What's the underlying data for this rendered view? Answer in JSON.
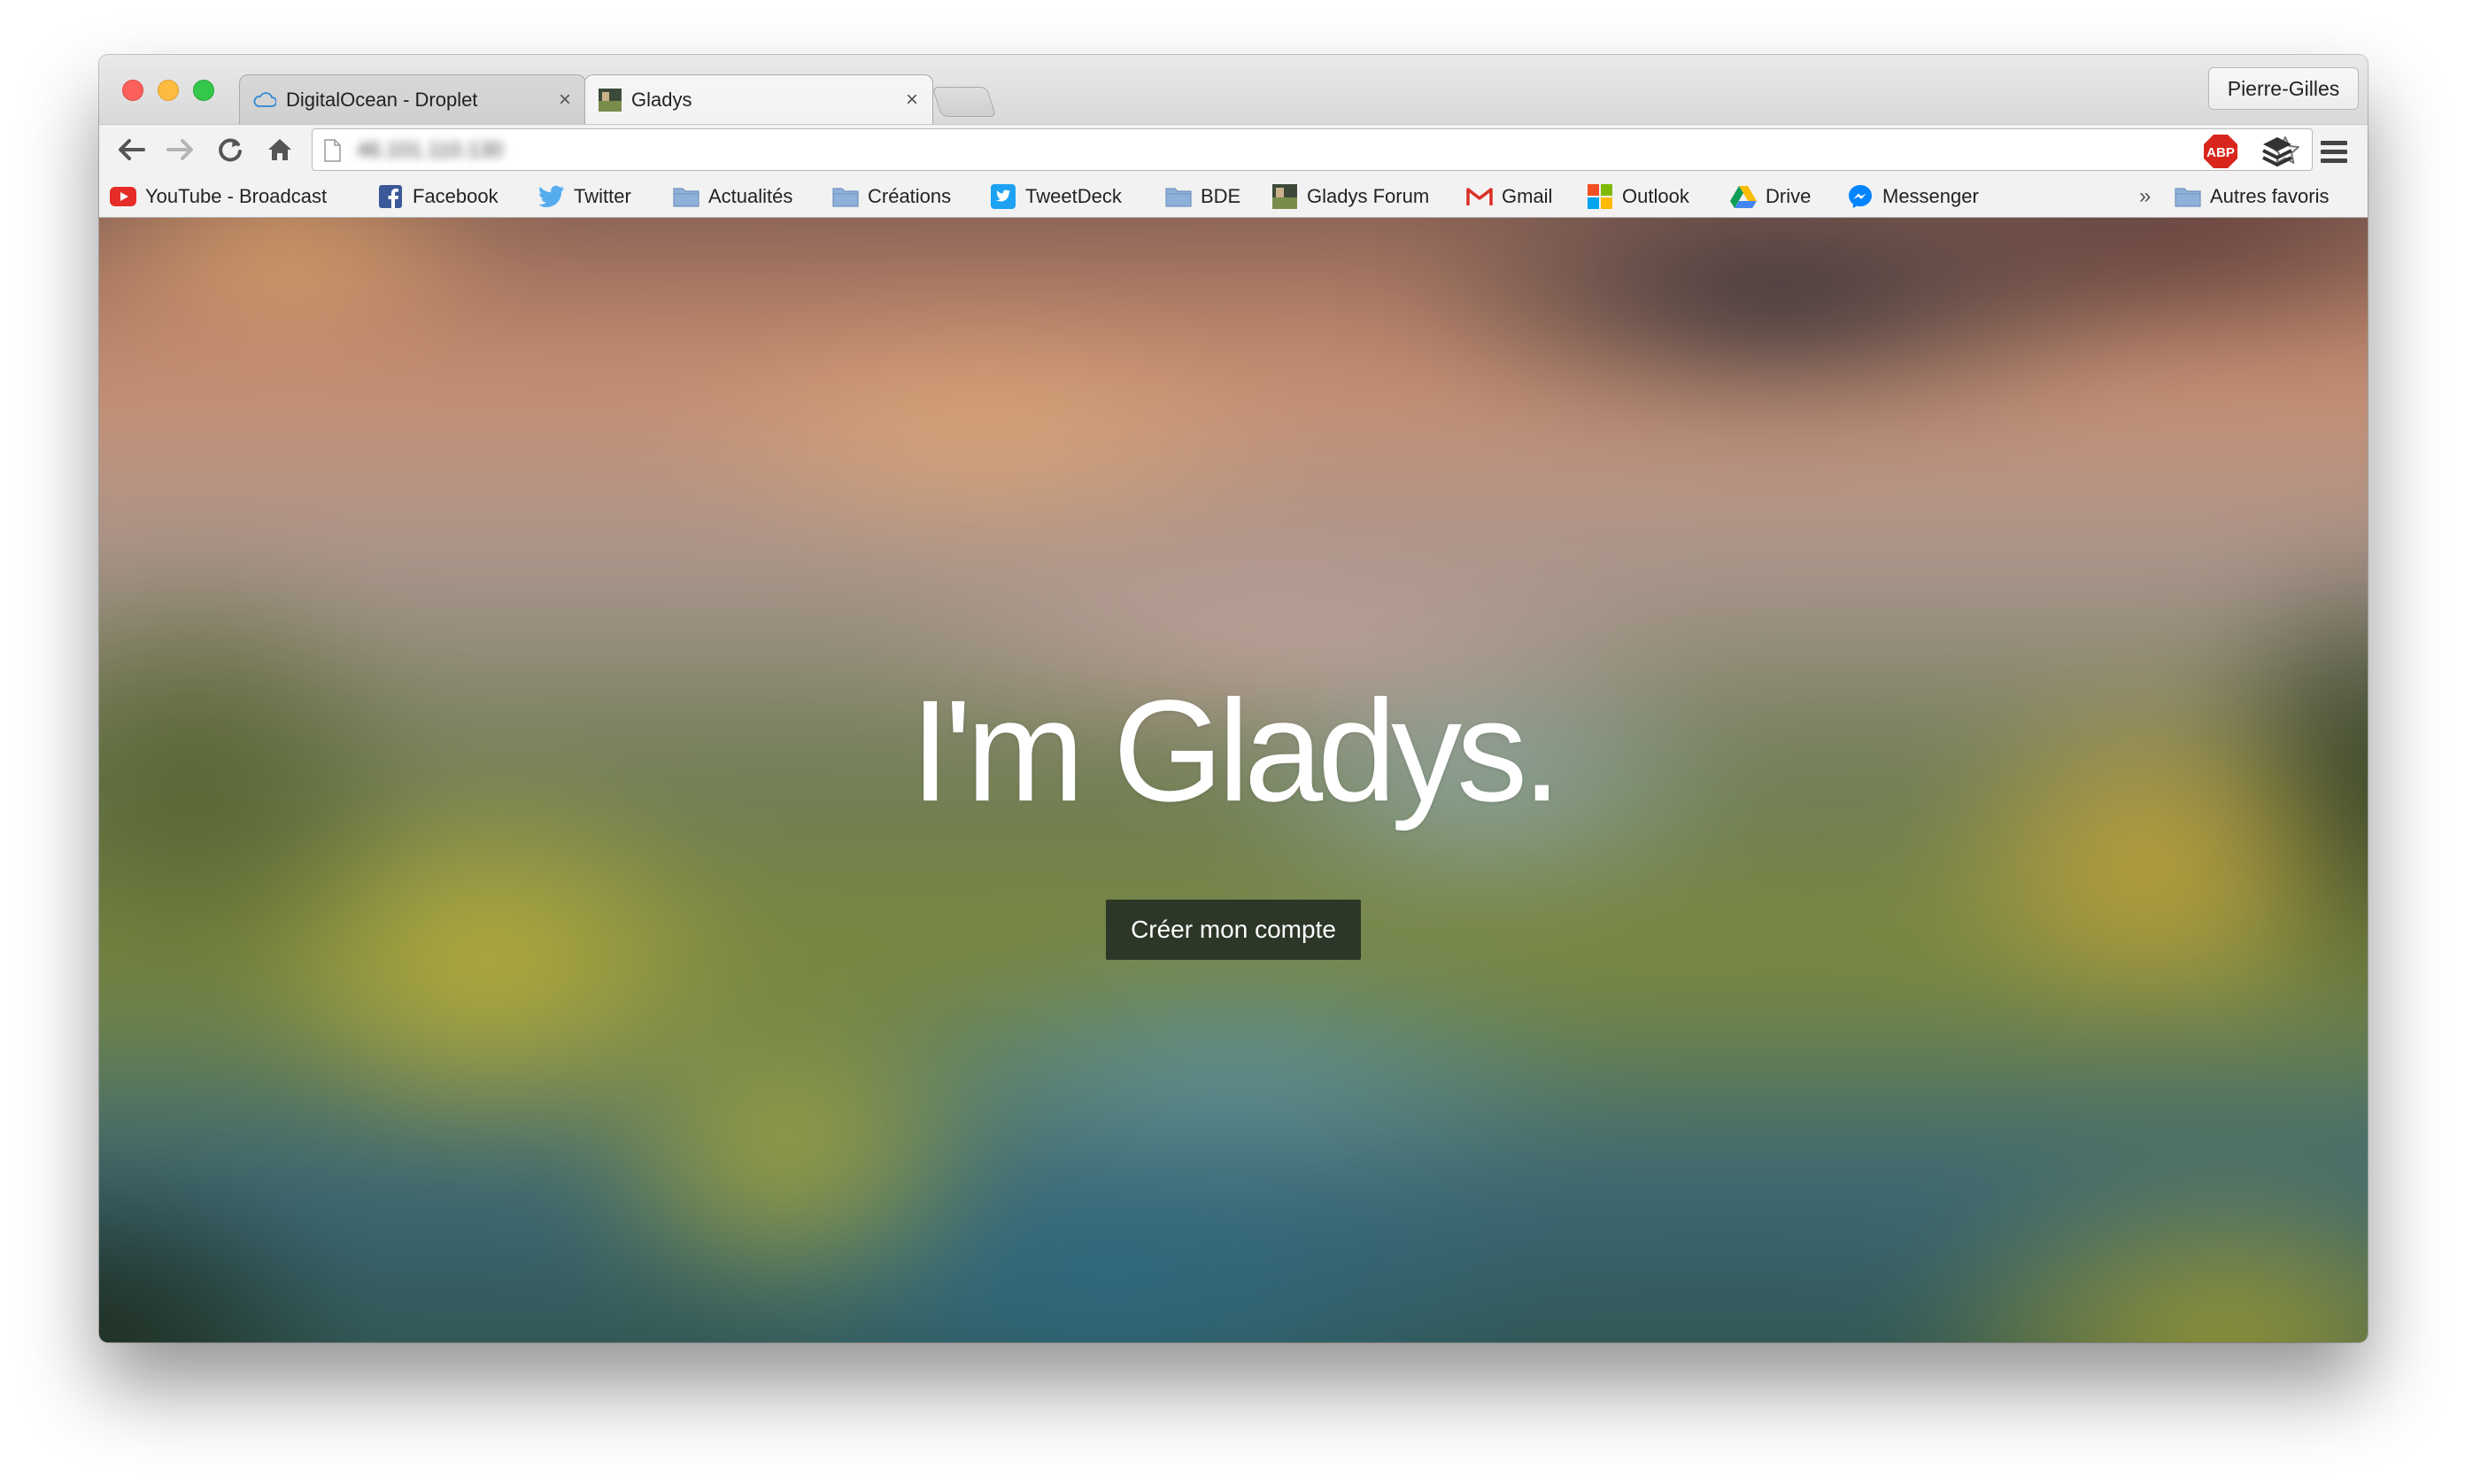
{
  "browser": {
    "tabs": [
      {
        "label": "DigitalOcean - Droplet",
        "close": "×",
        "active": false
      },
      {
        "label": "Gladys",
        "close": "×",
        "active": true
      }
    ],
    "profile_name": "Pierre-Gilles",
    "address_bar": {
      "url": "46.101.110.130"
    }
  },
  "bookmarks": [
    {
      "label": "YouTube - Broadcast",
      "icon": "youtube-icon"
    },
    {
      "label": "Facebook",
      "icon": "facebook-icon"
    },
    {
      "label": "Twitter",
      "icon": "twitter-bird-icon"
    },
    {
      "label": "Actualités",
      "icon": "folder-icon"
    },
    {
      "label": "Créations",
      "icon": "folder-icon"
    },
    {
      "label": "TweetDeck",
      "icon": "tweetdeck-icon"
    },
    {
      "label": "BDE",
      "icon": "folder-icon"
    },
    {
      "label": "Gladys Forum",
      "icon": "gladys-favicon-icon"
    },
    {
      "label": "Gmail",
      "icon": "gmail-icon"
    },
    {
      "label": "Outlook",
      "icon": "outlook-icon"
    },
    {
      "label": "Drive",
      "icon": "drive-icon"
    },
    {
      "label": "Messenger",
      "icon": "messenger-icon"
    }
  ],
  "bookmarks_overflow": "»",
  "other_bookmarks": "Autres favoris",
  "extensions": {
    "adblock_label": "ABP"
  },
  "page": {
    "headline": "I'm Gladys.",
    "cta_label": "Créer mon compte"
  },
  "colors": {
    "traffic_red": "#fc605c",
    "traffic_yellow": "#fdbc40",
    "traffic_green": "#34c84a",
    "button_bg": "#1c2620",
    "folder": "#8fb1d9"
  }
}
